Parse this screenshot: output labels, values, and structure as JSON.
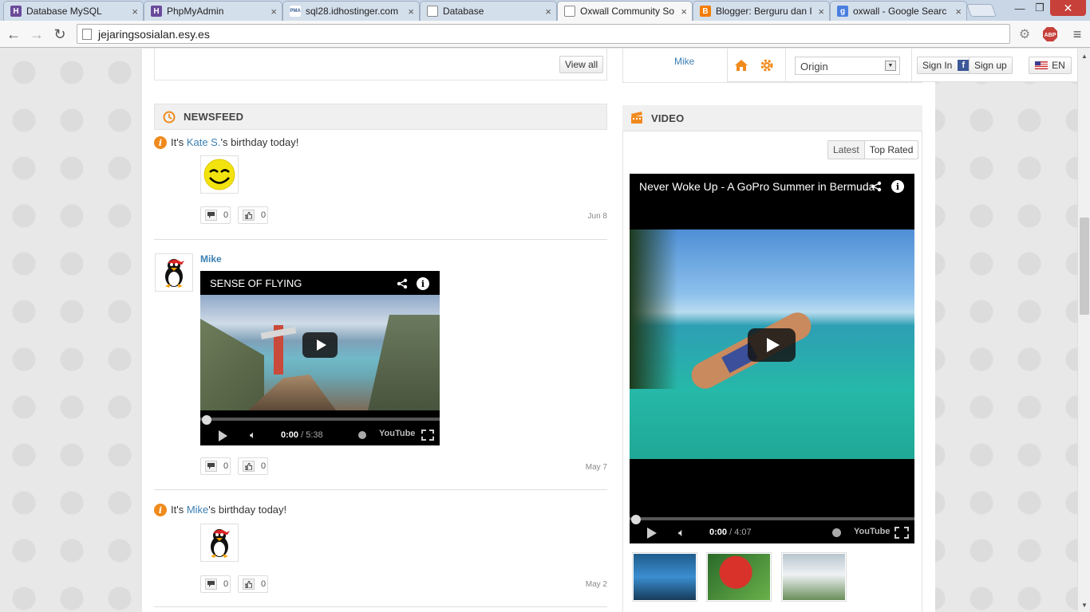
{
  "browser": {
    "tabs": [
      {
        "title": "Database MySQL",
        "icon": "phpmyadmin-icon"
      },
      {
        "title": "PhpMyAdmin",
        "icon": "phpmyadmin-icon"
      },
      {
        "title": "sql28.idhostinger.com",
        "icon": "pma-icon"
      },
      {
        "title": "Database",
        "icon": "page-icon"
      },
      {
        "title": "Oxwall Community So",
        "icon": "page-icon"
      },
      {
        "title": "Blogger: Berguru dan I",
        "icon": "blogger-icon"
      },
      {
        "title": "oxwall - Google Searc",
        "icon": "google-icon"
      }
    ],
    "active_tab_index": 4,
    "url": "jejaringsosialan.esy.es",
    "pma_label": "PMA",
    "abp_label": "ABP"
  },
  "console": {
    "theme_value": "Origin",
    "sign_in": "Sign In",
    "sign_up": "Sign up",
    "lang": "EN"
  },
  "top_box": {
    "view_all": "View all",
    "user_link": "Mike"
  },
  "newsfeed": {
    "title": "NEWSFEED",
    "items": [
      {
        "pre": "It's ",
        "name": "Kate S.",
        "post": "'s birthday today!",
        "comments": "0",
        "likes": "0",
        "date": "Jun 8"
      },
      {
        "author": "Mike",
        "video_title": "SENSE OF FLYING",
        "time_current": "0:00",
        "time_total": "/ 5:38",
        "comments": "0",
        "likes": "0",
        "date": "May 7"
      },
      {
        "pre": "It's ",
        "name": "Mike",
        "post": "'s birthday today!",
        "comments": "0",
        "likes": "0",
        "date": "May 2"
      }
    ],
    "youtube_label": "YouTube"
  },
  "video": {
    "title": "VIDEO",
    "tab_latest": "Latest",
    "tab_top_rated": "Top Rated",
    "player_title": "Never Woke Up - A GoPro Summer in Bermuda",
    "time_current": "0:00",
    "time_total": "/ 4:07"
  },
  "colors": {
    "accent_orange": "#f08a1d",
    "link_blue": "#3b7fb2",
    "close_red": "#c7403a"
  }
}
